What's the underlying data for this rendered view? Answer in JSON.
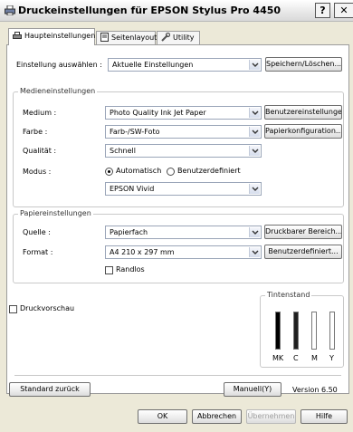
{
  "window": {
    "title": "Druckeinstellungen für EPSON Stylus Pro 4450",
    "help_glyph": "?",
    "close_glyph": "✕"
  },
  "tabs": [
    {
      "label": "Haupteinstellungen",
      "icon": "printer-icon"
    },
    {
      "label": "Seitenlayout",
      "icon": "page-icon"
    },
    {
      "label": "Utility",
      "icon": "wrench-icon"
    }
  ],
  "settings": {
    "label": "Einstellung auswählen :",
    "value": "Aktuelle Einstellungen",
    "save_button": "Speichern/Löschen..."
  },
  "media": {
    "group_title": "Medieneinstellungen",
    "medium_label": "Medium :",
    "medium_value": "Photo Quality Ink Jet Paper",
    "user_settings_button": "Benutzereinstellungen...",
    "color_label": "Farbe :",
    "color_value": "Farb-/SW-Foto",
    "paper_config_button": "Papierkonfiguration...",
    "quality_label": "Qualität :",
    "quality_value": "Schnell",
    "mode_label": "Modus :",
    "mode_auto": "Automatisch",
    "mode_custom": "Benutzerdefiniert",
    "mode_value": "EPSON Vivid"
  },
  "paper": {
    "group_title": "Papiereinstellungen",
    "source_label": "Quelle :",
    "source_value": "Papierfach",
    "printable_area_button": "Druckbarer Bereich...",
    "format_label": "Format :",
    "format_value": "A4 210 x 297 mm",
    "custom_button": "Benutzerdefiniert...",
    "borderless_label": "Randlos"
  },
  "preview": {
    "label": "Druckvorschau",
    "checked": false
  },
  "ink": {
    "group_title": "Tintenstand",
    "labels": [
      "MK",
      "C",
      "M",
      "Y"
    ],
    "colors": [
      "#000000",
      "#1f1f1f",
      "#ffffff",
      "#ffffff"
    ]
  },
  "bottom": {
    "default_button": "Standard zurück",
    "manual_button": "Manuell(Y)",
    "version": "Version 6.50"
  },
  "dialog_buttons": {
    "ok": "OK",
    "cancel": "Abbrechen",
    "apply": "Übernehmen",
    "help": "Hilfe"
  }
}
